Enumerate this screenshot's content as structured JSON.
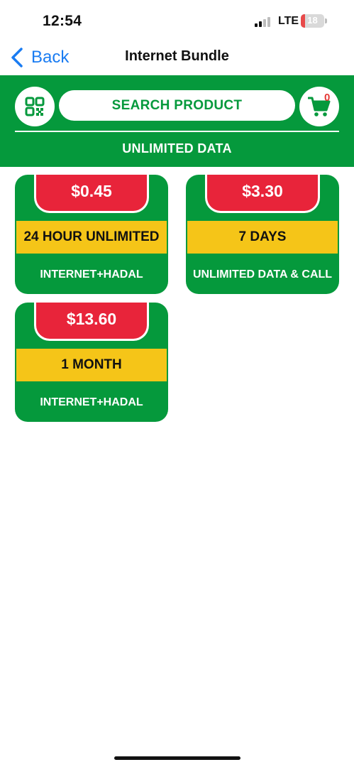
{
  "status_bar": {
    "time": "12:54",
    "network": "LTE",
    "battery": "18"
  },
  "nav": {
    "back_label": "Back",
    "title": "Internet Bundle"
  },
  "header": {
    "search_placeholder": "SEARCH PRODUCT",
    "cart_count": "0",
    "category": "UNLIMITED DATA"
  },
  "products": [
    {
      "price": "$0.45",
      "duration": "24 HOUR UNLIMITED",
      "description": "INTERNET+HADAL"
    },
    {
      "price": "$3.30",
      "duration": "7 DAYS",
      "description": "UNLIMITED DATA & CALL"
    },
    {
      "price": "$13.60",
      "duration": "1 MONTH",
      "description": "INTERNET+HADAL"
    }
  ],
  "colors": {
    "brand_green": "#05993c",
    "price_red": "#e8243a",
    "duration_yellow": "#f5c518",
    "link_blue": "#1a7cf2"
  },
  "icons": [
    "back-chevron-icon",
    "qr-code-icon",
    "cart-icon"
  ]
}
